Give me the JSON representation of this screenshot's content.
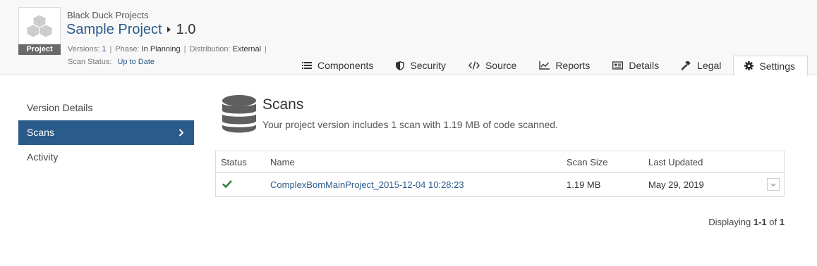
{
  "header": {
    "breadcrumb": "Black Duck Projects",
    "project_name": "Sample Project",
    "version": "1.0",
    "badge": "Project",
    "meta": {
      "versions_label": "Versions:",
      "versions_value": "1",
      "phase_label": "Phase:",
      "phase_value": "In Planning",
      "distribution_label": "Distribution:",
      "distribution_value": "External",
      "scan_status_label": "Scan Status:",
      "scan_status_value": "Up to Date"
    }
  },
  "tabs": [
    {
      "label": "Components",
      "icon": "list-icon"
    },
    {
      "label": "Security",
      "icon": "shield-icon"
    },
    {
      "label": "Source",
      "icon": "code-icon"
    },
    {
      "label": "Reports",
      "icon": "line-chart-icon"
    },
    {
      "label": "Details",
      "icon": "id-card-icon"
    },
    {
      "label": "Legal",
      "icon": "gavel-icon"
    },
    {
      "label": "Settings",
      "icon": "gear-icon",
      "active": true
    }
  ],
  "sidenav": {
    "items": [
      {
        "label": "Version Details"
      },
      {
        "label": "Scans",
        "active": true
      },
      {
        "label": "Activity"
      }
    ]
  },
  "scans": {
    "title": "Scans",
    "description": "Your project version includes 1 scan with 1.19 MB of code scanned.",
    "table": {
      "columns": [
        "Status",
        "Name",
        "Scan Size",
        "Last Updated"
      ],
      "rows": [
        {
          "status": "success",
          "name": "ComplexBomMainProject_2015-12-04 10:28:23",
          "size": "1.19 MB",
          "updated": "May 29, 2019"
        }
      ]
    },
    "paging": {
      "prefix": "Displaying",
      "range": "1-1",
      "of": "of",
      "total": "1"
    }
  },
  "colors": {
    "brand_blue": "#2b5b8b",
    "success_green": "#3a7d3a",
    "badge_gray": "#6a6a6a"
  }
}
